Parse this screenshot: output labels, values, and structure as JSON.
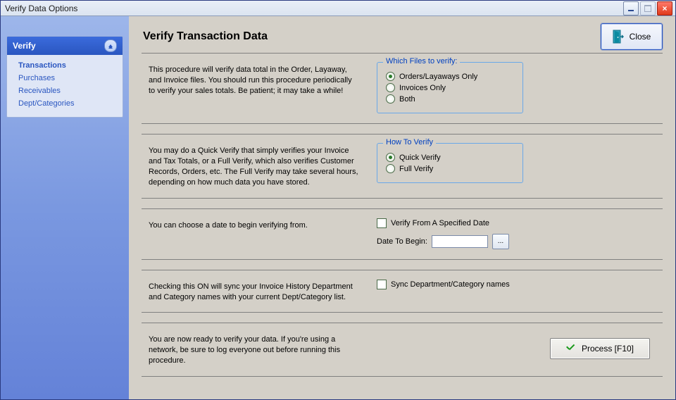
{
  "window_title": "Verify Data Options",
  "close_button_label": "Close",
  "sidebar": {
    "header": "Verify",
    "items": [
      {
        "label": "Transactions",
        "active": true
      },
      {
        "label": "Purchases",
        "active": false
      },
      {
        "label": "Receivables",
        "active": false
      },
      {
        "label": "Dept/Categories",
        "active": false
      }
    ]
  },
  "page_title": "Verify Transaction Data",
  "sections": {
    "files": {
      "desc": "This procedure will verify data total in the Order, Layaway, and Invoice files.  You should run this procedure periodically to verify your sales totals.  Be patient; it may take a while!",
      "group_title": "Which Files to verify:",
      "options": [
        {
          "label": "Orders/Layaways Only",
          "checked": true
        },
        {
          "label": "Invoices Only",
          "checked": false
        },
        {
          "label": "Both",
          "checked": false
        }
      ]
    },
    "how": {
      "desc": "You may do a Quick Verify that simply verifies your Invoice and Tax Totals, or a Full Verify, which also verifies Customer Records, Orders, etc.  The Full Verify may take several hours, depending on how much data you have stored.",
      "group_title": "How To Verify",
      "options": [
        {
          "label": "Quick Verify",
          "checked": true
        },
        {
          "label": "Full Verify",
          "checked": false
        }
      ]
    },
    "date": {
      "desc": "You can choose a date to begin verifying from.",
      "checkbox_label": "Verify From A Specified Date",
      "date_label": "Date To Begin:",
      "date_value": "",
      "date_picker_label": "..."
    },
    "sync": {
      "desc": "Checking this ON will sync your Invoice History Department and Category names with your current Dept/Category list.",
      "checkbox_label": "Sync Department/Category names"
    },
    "process": {
      "desc": "You are now ready to verify your data.  If you're using a network, be sure to log everyone out before running this procedure.",
      "button_label": "Process [F10]"
    }
  }
}
